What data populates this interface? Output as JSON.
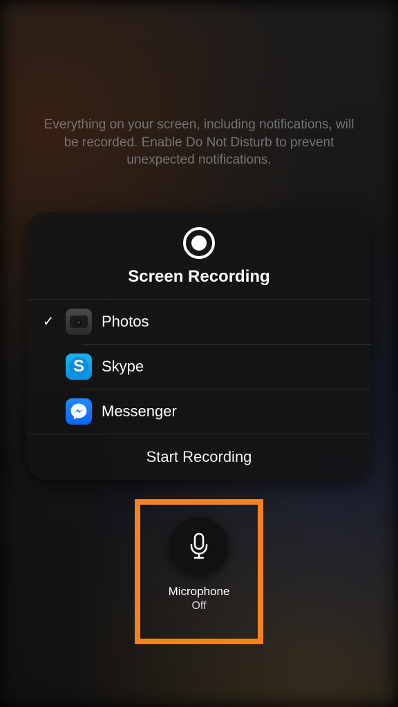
{
  "notice": "Everything on your screen, including notifications, will be recorded. Enable Do Not Disturb to prevent unexpected notifications.",
  "panel": {
    "title": "Screen Recording",
    "start_label": "Start Recording"
  },
  "apps": [
    {
      "label": "Photos",
      "icon": "photos-icon",
      "selected": true
    },
    {
      "label": "Skype",
      "icon": "skype-icon",
      "selected": false
    },
    {
      "label": "Messenger",
      "icon": "messenger-icon",
      "selected": false
    }
  ],
  "microphone": {
    "label": "Microphone",
    "state": "Off"
  },
  "highlight_color": "#f58220"
}
